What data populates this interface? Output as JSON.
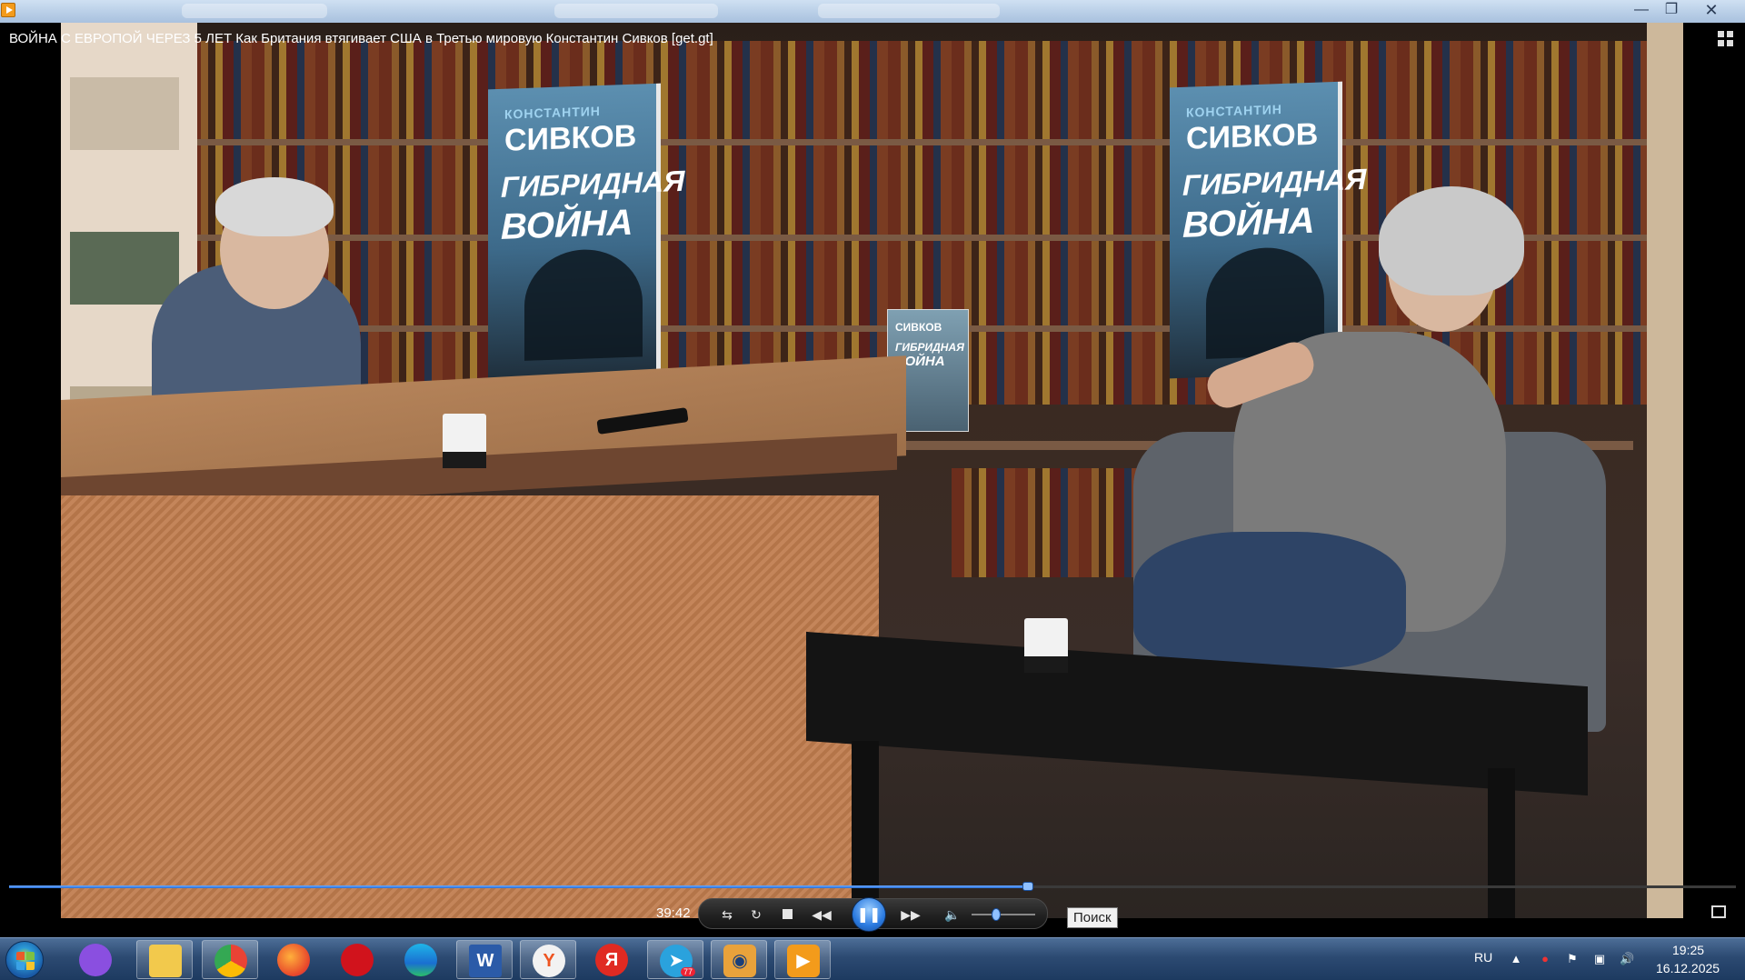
{
  "window": {
    "title": "ВОЙНА С ЕВРОПОЙ ЧЕРЕЗ 5 ЛЕТ Как Британия втягивает США в Третью мировую Константин Сивков [get.gt]",
    "minimize_icon": "minimize-icon",
    "maximize_icon": "restore-icon",
    "close_icon": "close-icon"
  },
  "video": {
    "poster_author": "КОНСТАНТИН",
    "poster_surname": "СИВКОВ",
    "poster_title_line1": "ГИБРИДНАЯ",
    "poster_title_line2": "ВОЙНА",
    "book_surname": "СИВКОВ",
    "book_title_line1": "ГИБРИДНАЯ",
    "book_title_line2": "ВОЙНА"
  },
  "player": {
    "time": "39:42",
    "progress_fraction": 0.59,
    "volume_fraction": 0.35,
    "muted": false,
    "state": "playing",
    "tooltip": "Поиск",
    "colors": {
      "accent": "#2b7ae0",
      "track": "#3a3a3a"
    }
  },
  "taskbar": {
    "apps": [
      {
        "name": "alice-icon",
        "active": false
      },
      {
        "name": "file-explorer-icon",
        "active": true
      },
      {
        "name": "chrome-icon",
        "active": true
      },
      {
        "name": "firefox-icon",
        "active": false
      },
      {
        "name": "opera-icon",
        "active": false
      },
      {
        "name": "edge-icon",
        "active": false
      },
      {
        "name": "word-icon",
        "active": true,
        "label": "W"
      },
      {
        "name": "yandex-browser-icon",
        "active": true
      },
      {
        "name": "yandex-icon",
        "active": false,
        "label": "Я"
      },
      {
        "name": "telegram-icon",
        "active": true,
        "badge": "77"
      },
      {
        "name": "eye-app-icon",
        "active": true
      },
      {
        "name": "media-player-icon",
        "active": true
      }
    ],
    "language": "RU",
    "clock_time": "19:25",
    "clock_date": "16.12.2025"
  }
}
